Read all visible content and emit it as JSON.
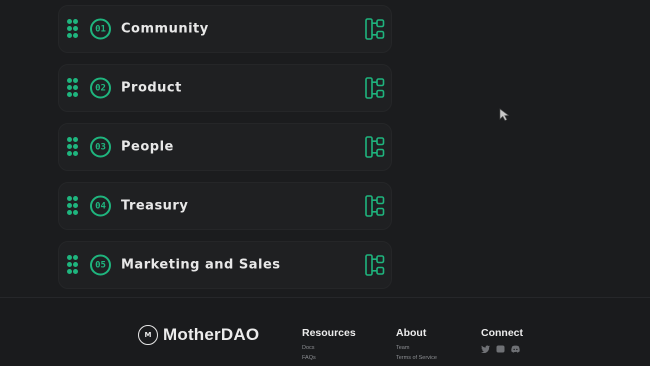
{
  "items": [
    {
      "num": "01",
      "label": "Community"
    },
    {
      "num": "02",
      "label": "Product"
    },
    {
      "num": "03",
      "label": "People"
    },
    {
      "num": "04",
      "label": "Treasury"
    },
    {
      "num": "05",
      "label": "Marketing and Sales"
    }
  ],
  "footer": {
    "brand": {
      "logo_text": "M",
      "name": "MotherDAO"
    },
    "resources": {
      "title": "Resources",
      "links": [
        "Docs",
        "FAQs"
      ]
    },
    "about": {
      "title": "About",
      "links": [
        "Team",
        "Terms of Service"
      ]
    },
    "connect": {
      "title": "Connect",
      "icons": [
        "twitter-icon",
        "github-icon",
        "discord-icon"
      ]
    }
  },
  "colors": {
    "accent": "#1fb57e",
    "background": "#1b1c1e",
    "card": "#1f2022"
  }
}
